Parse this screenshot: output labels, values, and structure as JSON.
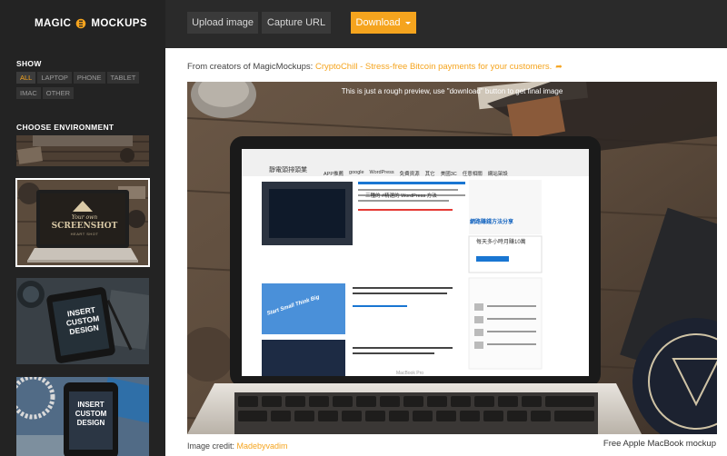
{
  "brand": {
    "name_left": "MAGIC",
    "name_right": "MOCKUPS",
    "accent_color": "#f5a41e"
  },
  "sidebar": {
    "show_label": "SHOW",
    "filters": [
      {
        "label": "ALL",
        "active": true
      },
      {
        "label": "LAPTOP",
        "active": false
      },
      {
        "label": "PHONE",
        "active": false
      },
      {
        "label": "TABLET",
        "active": false
      },
      {
        "label": "IMAC",
        "active": false
      },
      {
        "label": "OTHER",
        "active": false
      }
    ],
    "environment_label": "CHOOSE ENVIRONMENT",
    "thumbnails": [
      {
        "caption": "",
        "selected": false
      },
      {
        "caption_small": "Your own",
        "caption_big": "SCREENSHOT",
        "caption_sub": "HEART SHOT",
        "selected": true
      },
      {
        "caption_lines": [
          "INSERT",
          "CUSTOM",
          "DESIGN"
        ],
        "selected": false
      },
      {
        "caption_lines": [
          "INSERT",
          "CUSTOM",
          "DESIGN"
        ],
        "selected": false
      }
    ]
  },
  "toolbar": {
    "upload_label": "Upload image",
    "capture_label": "Capture URL",
    "download_label": "Download"
  },
  "promo": {
    "prefix": "From creators of MagicMockups: ",
    "link_text": "CryptoChill - Stress-free Bitcoin payments for your customers.",
    "share_icon": "share-arrow-icon"
  },
  "preview": {
    "notice": "This is just a rough preview, use \"download\" button to get final image",
    "laptop_label": "MacBook Pro",
    "site_title": "靜電頭排頭業",
    "site_nav": [
      "APP推薦",
      "google",
      "WordPress",
      "免費資源",
      "其它",
      "美國3C",
      "任意相關",
      "網站架設"
    ],
    "article_headline": "三種的 #精選的 WordPress 方法",
    "side_title": "網路賺錢方法分享",
    "side_heading": "每天多小時月賺10萬",
    "card_text": "Start Small Think Big"
  },
  "credit": {
    "prefix": "Image credit: ",
    "author": "Madebyvadim"
  },
  "mockup_name": "Free Apple MacBook mockup"
}
